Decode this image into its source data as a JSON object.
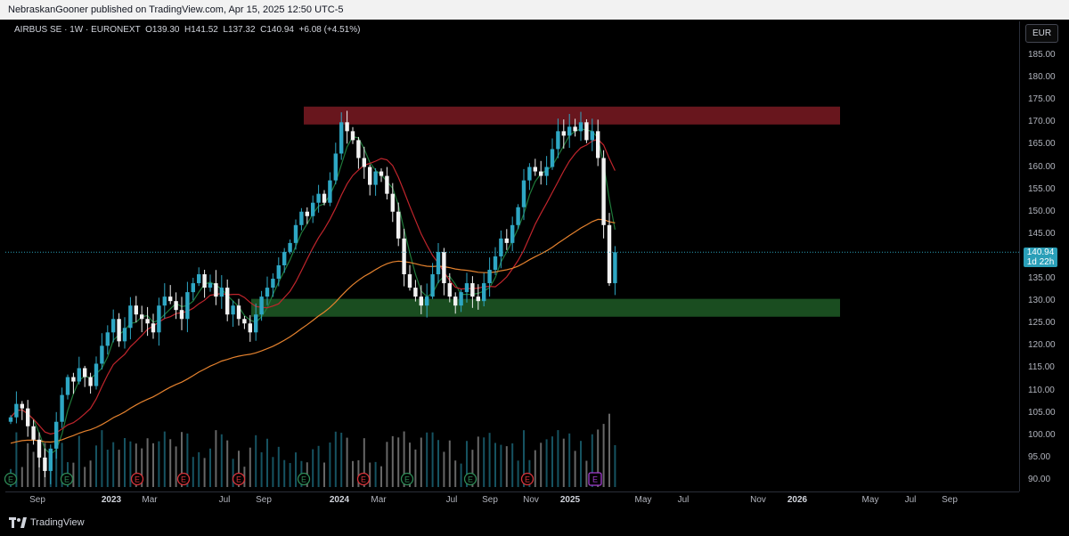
{
  "header": {
    "published_text": "NebraskanGooner published on TradingView.com, Apr 15, 2025 12:50 UTC-5"
  },
  "legend": {
    "symbol": "AIRBUS SE · 1W · EURONEXT",
    "open_label": "O",
    "open": "139.30",
    "high_label": "H",
    "high": "141.52",
    "low_label": "L",
    "low": "137.32",
    "close_label": "C",
    "close": "140.94",
    "change": "+6.08 (+4.51%)"
  },
  "currency": "EUR",
  "last_price": {
    "value": "140.94",
    "countdown": "1d 22h"
  },
  "price_ticks": [
    "185.00",
    "180.00",
    "175.00",
    "170.00",
    "165.00",
    "160.00",
    "155.00",
    "150.00",
    "145.00",
    "140.00",
    "135.00",
    "130.00",
    "125.00",
    "120.00",
    "115.00",
    "110.00",
    "105.00",
    "100.00",
    "95.00",
    "90.00"
  ],
  "time_ticks": [
    {
      "label": "Sep",
      "year": false
    },
    {
      "label": "2023",
      "year": true
    },
    {
      "label": "Mar",
      "year": false
    },
    {
      "label": "Jul",
      "year": false
    },
    {
      "label": "Sep",
      "year": false
    },
    {
      "label": "2024",
      "year": true
    },
    {
      "label": "Mar",
      "year": false
    },
    {
      "label": "Jul",
      "year": false
    },
    {
      "label": "Sep",
      "year": false
    },
    {
      "label": "Nov",
      "year": false
    },
    {
      "label": "2025",
      "year": true
    },
    {
      "label": "May",
      "year": false
    },
    {
      "label": "Jul",
      "year": false
    },
    {
      "label": "Nov",
      "year": false
    },
    {
      "label": "2026",
      "year": true
    },
    {
      "label": "May",
      "year": false
    },
    {
      "label": "Jul",
      "year": false
    },
    {
      "label": "Sep",
      "year": false
    }
  ],
  "footer": {
    "brand": "TradingView"
  },
  "colors": {
    "up": "#2ea7c4",
    "down": "#f2f2f2",
    "resistance_zone": "#7a1a22",
    "support_zone": "#1e5a26",
    "ma_short": "#1f7a3a",
    "ma_mid": "#c0252c",
    "ma_long": "#e5822e",
    "last_price_line": "#2a9fb8",
    "earnings_red": "#d8333a",
    "earnings_green": "#2e8b57",
    "earnings_next": "#a43cd1"
  },
  "chart_data": {
    "type": "candlestick",
    "symbol": "AIRBUS SE",
    "interval": "1W",
    "exchange": "EURONEXT",
    "currency": "EUR",
    "ylim": [
      88,
      188
    ],
    "zones": [
      {
        "name": "resistance",
        "from": 169.5,
        "to": 173.5
      },
      {
        "name": "support",
        "from": 126.5,
        "to": 130.5
      }
    ],
    "last_close": 140.94,
    "earnings_markers": [
      {
        "label": "E",
        "kind": "green"
      },
      {
        "label": "E",
        "kind": "green"
      },
      {
        "label": "E",
        "kind": "red"
      },
      {
        "label": "E",
        "kind": "red"
      },
      {
        "label": "E",
        "kind": "red"
      },
      {
        "label": "E",
        "kind": "green"
      },
      {
        "label": "E",
        "kind": "red"
      },
      {
        "label": "E",
        "kind": "green"
      },
      {
        "label": "E",
        "kind": "green"
      },
      {
        "label": "E",
        "kind": "red"
      },
      {
        "label": "E",
        "kind": "next"
      }
    ],
    "closes": [
      104,
      107,
      106,
      102,
      99,
      95,
      92,
      97,
      103,
      109,
      113,
      112,
      115,
      113,
      111,
      116,
      120,
      123,
      126,
      121,
      124,
      129,
      127,
      126,
      125,
      123,
      129,
      131,
      130,
      128,
      126,
      132,
      134,
      136,
      133,
      134,
      131,
      133,
      127,
      129,
      126,
      125,
      123,
      127,
      131,
      133,
      135,
      138,
      141,
      143,
      147,
      150,
      149,
      152,
      154,
      152,
      157,
      163,
      170,
      168,
      166,
      162,
      160,
      156,
      159,
      158,
      154,
      150,
      144,
      136,
      133,
      131,
      129,
      131,
      136,
      141,
      134,
      131,
      129,
      132,
      134,
      131,
      130,
      134,
      137,
      140,
      144,
      143,
      147,
      151,
      157,
      160,
      159,
      158,
      160,
      164,
      168,
      167,
      169,
      168,
      170,
      166,
      168,
      162,
      147,
      134,
      140.94
    ]
  }
}
